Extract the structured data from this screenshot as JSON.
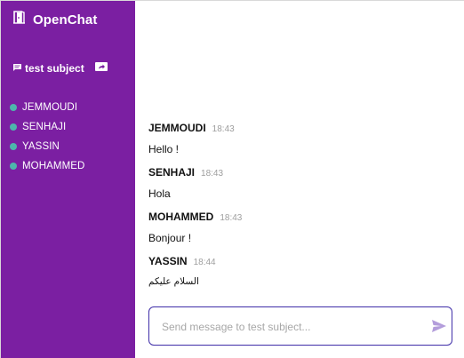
{
  "app": {
    "title": "OpenChat"
  },
  "room": {
    "name": "test subject"
  },
  "users": [
    {
      "name": "JEMMOUDI"
    },
    {
      "name": "SENHAJI"
    },
    {
      "name": "YASSIN"
    },
    {
      "name": "MOHAMMED"
    }
  ],
  "messages": [
    {
      "user": "JEMMOUDI",
      "time": "18:43",
      "text": "Hello !"
    },
    {
      "user": "SENHAJI",
      "time": "18:43",
      "text": "Hola"
    },
    {
      "user": "MOHAMMED",
      "time": "18:43",
      "text": "Bonjour !"
    },
    {
      "user": "YASSIN",
      "time": "18:44",
      "text": "السلام عليكم"
    }
  ],
  "composer": {
    "placeholder": "Send message to test subject..."
  },
  "colors": {
    "sidebar": "#7b1fa2",
    "online": "#4db6ac",
    "accent": "#3f2ea8",
    "send": "#b39ddb"
  },
  "icons": {
    "brand": "door-exit-icon",
    "room": "chat-bubble-icon",
    "share": "share-screen-icon",
    "send": "send-icon"
  }
}
